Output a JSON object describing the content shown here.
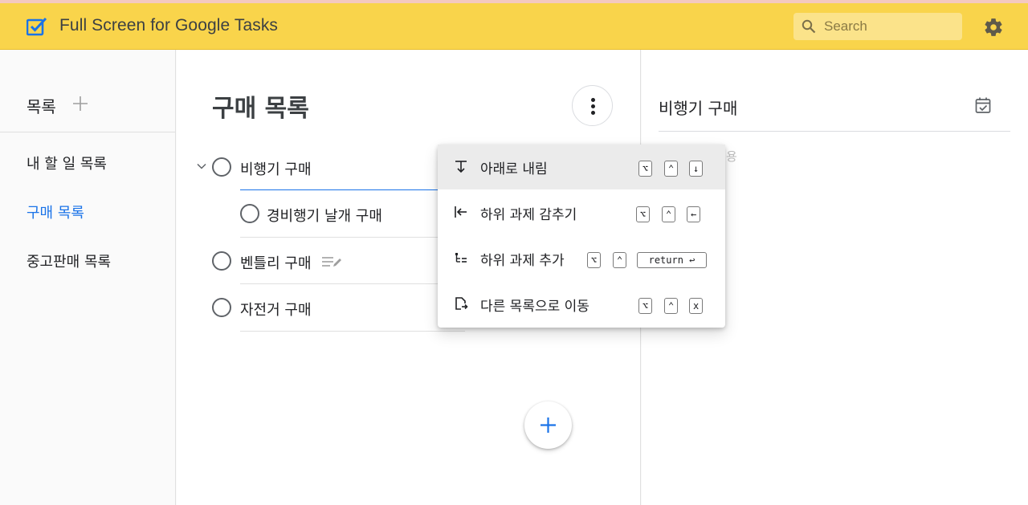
{
  "app": {
    "title": "Full Screen for Google Tasks",
    "search_placeholder": "Search",
    "colors": {
      "header": "#f9d44b",
      "accent": "#1a73e8"
    }
  },
  "sidebar": {
    "heading": "목록",
    "items": [
      {
        "label": "내 할 일 목록",
        "active": false
      },
      {
        "label": "구매 목록",
        "active": true
      },
      {
        "label": "중고판매 목록",
        "active": false
      }
    ]
  },
  "main": {
    "list_title": "구매 목록",
    "tasks": [
      {
        "title": "비행기 구매",
        "expanded": true
      },
      {
        "title": "경비행기 날개 구매",
        "subtask": true
      },
      {
        "title": "벤틀리 구매",
        "has_notes": true
      },
      {
        "title": "자전거 구매"
      }
    ]
  },
  "context_menu": {
    "items": [
      {
        "label": "아래로 내림",
        "icon": "move-down-icon",
        "keys": [
          "⌥",
          "⌃",
          "↓"
        ]
      },
      {
        "label": "하위 과제 감추기",
        "icon": "outdent-icon",
        "keys": [
          "⌥",
          "⌃",
          "←"
        ]
      },
      {
        "label": "하위 과제 추가",
        "icon": "add-subtask-icon",
        "keys": [
          "⌥",
          "⌃",
          "return ↩"
        ]
      },
      {
        "label": "다른 목록으로 이동",
        "icon": "move-to-list-icon",
        "keys": [
          "⌥",
          "⌃",
          "x"
        ]
      }
    ]
  },
  "detail": {
    "title": "비행기 구매",
    "notes_placeholder_partial": "용"
  }
}
